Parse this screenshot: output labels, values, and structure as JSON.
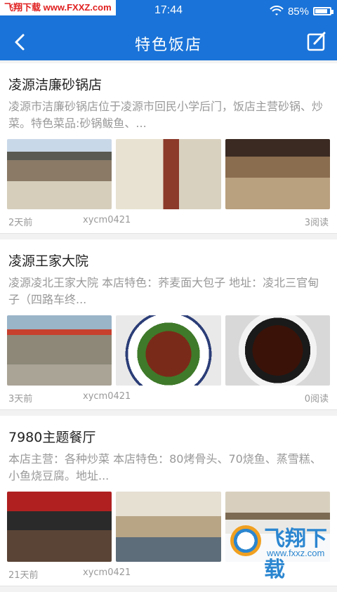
{
  "statusbar": {
    "watermark": "飞翔下载 www.FXXZ.com",
    "time": "17:44",
    "battery": "85%",
    "battery_level": 0.85
  },
  "navbar": {
    "title": "特色饭店",
    "back_icon": "chevron-left-icon",
    "edit_icon": "edit-icon"
  },
  "restaurants": [
    {
      "name": "凌源洁廉砂锅店",
      "desc": "凌源市洁廉砂锅店位于凌源市回民小学后门，饭店主营砂锅、炒菜。特色菜品:砂锅鲅鱼、...",
      "ago": "2天前",
      "author": "xycm0421",
      "reads": "3阅读"
    },
    {
      "name": "凌源王家大院",
      "desc": "凌源凌北王家大院   本店特色：荞麦面大包子   地址：凌北三官甸子（四路车终...",
      "ago": "3天前",
      "author": "xycm0421",
      "reads": "0阅读"
    },
    {
      "name": "7980主题餐厅",
      "desc": "本店主营：各种炒菜   本店特色：80烤骨头、70烧鱼、蒸雪糕、小鱼烧豆腐。地址...",
      "ago": "21天前",
      "author": "xycm0421",
      "reads": ""
    }
  ],
  "watermark_badge": {
    "big": "飞翔下载",
    "small": "www.fxxz.com"
  }
}
